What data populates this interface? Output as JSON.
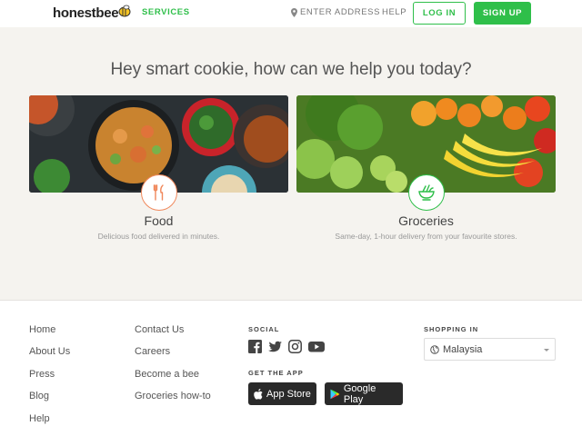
{
  "header": {
    "logo": "honestbee",
    "services": "SERVICES",
    "address": "ENTER ADDRESS",
    "help": "HELP",
    "login": "LOG IN",
    "signup": "SIGN UP"
  },
  "hero": {
    "title": "Hey smart cookie, how can we help you today?",
    "cards": [
      {
        "label": "Food",
        "sub": "Delicious food delivered in minutes.",
        "icon": "fork-knife-icon"
      },
      {
        "label": "Groceries",
        "sub": "Same-day, 1-hour delivery from your favourite stores.",
        "icon": "grocery-bowl-icon"
      }
    ]
  },
  "footer": {
    "col1": [
      "Home",
      "About Us",
      "Press",
      "Blog",
      "Help"
    ],
    "col2": [
      "Contact Us",
      "Careers",
      "Become a bee",
      "Groceries how-to"
    ],
    "social_heading": "SOCIAL",
    "social_icons": [
      "facebook-icon",
      "twitter-icon",
      "instagram-icon",
      "youtube-icon"
    ],
    "app_heading": "GET THE APP",
    "app_store": "App Store",
    "google_play": "Google Play",
    "shopping_heading": "SHOPPING IN",
    "country": "Malaysia"
  },
  "colors": {
    "brand": "#2fbf4a",
    "food_accent": "#f0875a"
  }
}
